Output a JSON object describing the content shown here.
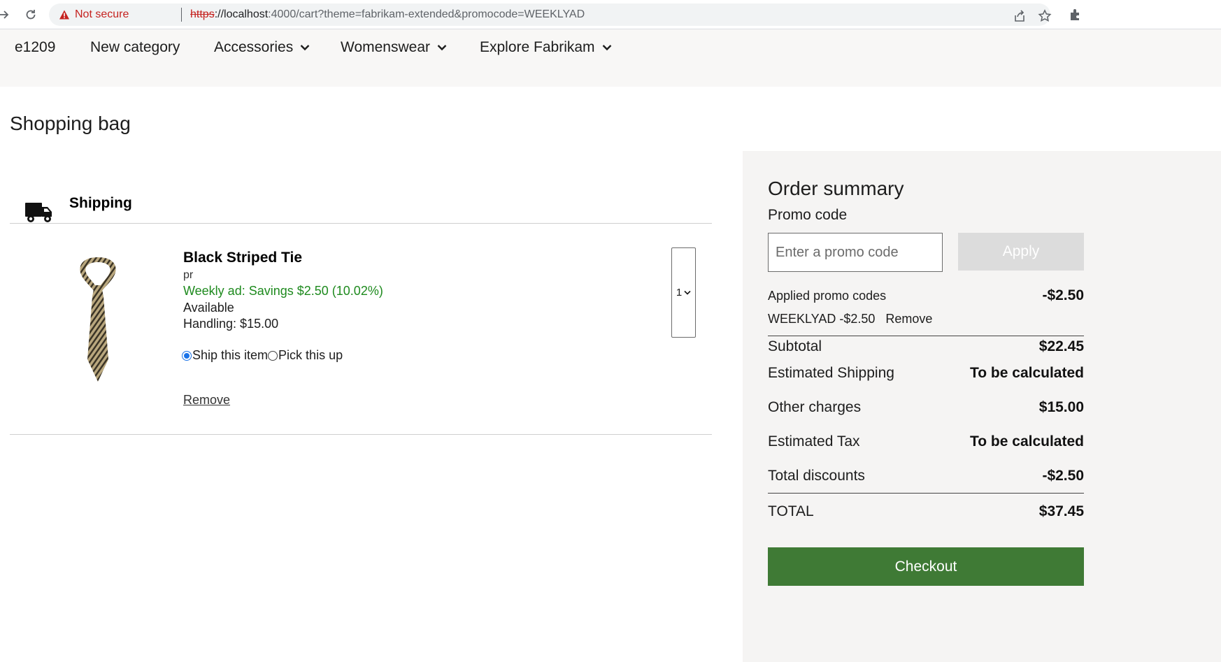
{
  "browser": {
    "security_label": "Not secure",
    "url_scheme": "https",
    "url_host": "://localhost",
    "url_rest": ":4000/cart?theme=fabrikam-extended&promocode=WEEKLYAD"
  },
  "nav": {
    "items": [
      {
        "label": "e1209",
        "has_dropdown": false
      },
      {
        "label": "New category",
        "has_dropdown": false
      },
      {
        "label": "Accessories",
        "has_dropdown": true
      },
      {
        "label": "Womenswear",
        "has_dropdown": true
      },
      {
        "label": "Explore Fabrikam",
        "has_dropdown": true
      }
    ]
  },
  "page": {
    "title": "Shopping bag"
  },
  "shipping": {
    "label": "Shipping"
  },
  "cart_item": {
    "name": "Black Striped Tie",
    "variant": "pr",
    "savings": "Weekly ad: Savings $2.50 (10.02%)",
    "availability": "Available",
    "handling": "Handling: $15.00",
    "option_ship": "Ship this item",
    "option_pickup": "Pick this up",
    "remove_label": "Remove",
    "quantity": "1"
  },
  "summary": {
    "title": "Order summary",
    "promo_label": "Promo code",
    "promo_placeholder": "Enter a promo code",
    "apply_label": "Apply",
    "applied_label": "Applied promo codes",
    "applied_value": "-$2.50",
    "applied_code": "WEEKLYAD -$2.50",
    "applied_remove": "Remove",
    "subtotal_label": "Subtotal",
    "subtotal_value": "$22.45",
    "shipping_label": "Estimated Shipping",
    "shipping_value": "To be calculated",
    "other_label": "Other charges",
    "other_value": "$15.00",
    "tax_label": "Estimated Tax",
    "tax_value": "To be calculated",
    "discounts_label": "Total discounts",
    "discounts_value": "-$2.50",
    "total_label": "TOTAL",
    "total_value": "$37.45",
    "checkout_label": "Checkout"
  },
  "colors": {
    "checkout": "#3f7a35",
    "savings": "#1e8a1e",
    "insecure": "#c5221f"
  }
}
